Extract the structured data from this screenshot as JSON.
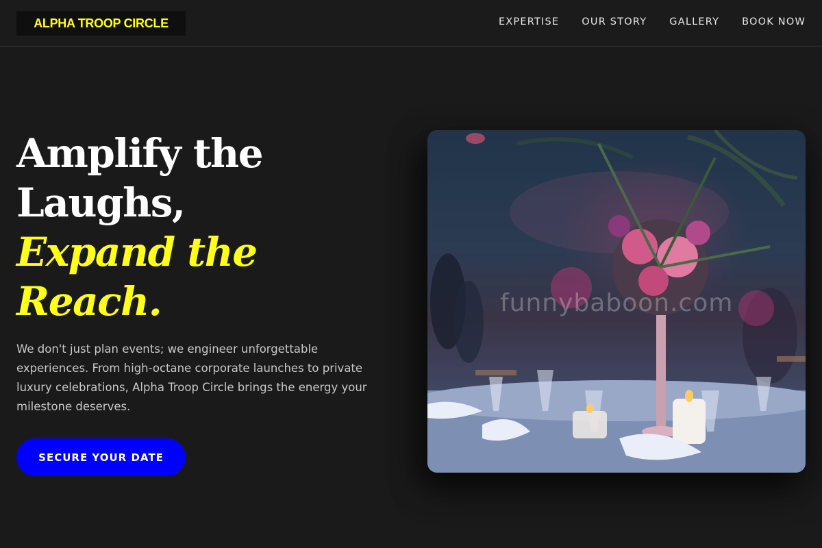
{
  "header": {
    "logo": "ALPHA TROOP CIRCLE",
    "nav": [
      "EXPERTISE",
      "OUR STORY",
      "GALLERY",
      "BOOK NOW"
    ]
  },
  "hero": {
    "title_lines": [
      "Amplify the",
      "Laughs,",
      "Expand the",
      "Reach."
    ],
    "description": "We don't just plan events; we engineer unforgettable experiences. From high-octane corporate launches to private luxury celebrations, Alpha Troop Circle brings the energy your milestone deserves.",
    "cta_label": "SECURE YOUR DATE"
  },
  "image": {
    "watermark": "funnybaboon.com"
  },
  "colors": {
    "background": "#1a1a1a",
    "accent_yellow": "#ffff1a",
    "cta_blue": "#0000ff",
    "text_white": "#ffffff",
    "text_muted": "#c9c9c9"
  }
}
